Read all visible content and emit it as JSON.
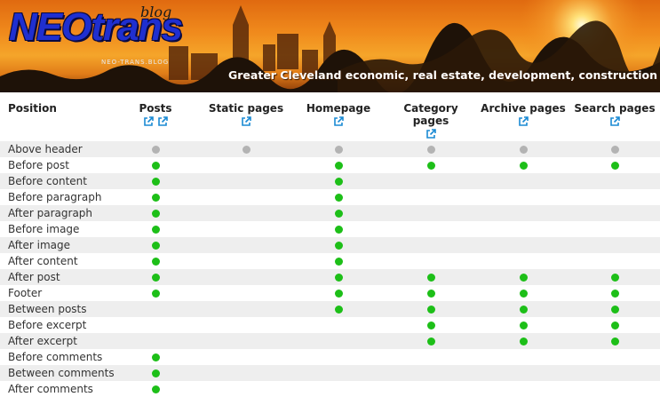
{
  "banner": {
    "logo": "NEOtrans",
    "logo_suffix": "blog",
    "site_url": "NEO-TRANS.BLOG",
    "tagline": "Greater Cleveland economic, real estate, development, construction news"
  },
  "colors": {
    "active_dot": "#1dbf18",
    "inactive_dot": "#b3b3b3",
    "link_icon": "#1a8ad4",
    "stripe": "#eeeeee"
  },
  "table": {
    "position_header": "Position",
    "columns": [
      {
        "label": "Posts",
        "link_icons": 2
      },
      {
        "label": "Static pages",
        "link_icons": 1
      },
      {
        "label": "Homepage",
        "link_icons": 1
      },
      {
        "label": "Category pages",
        "link_icons": 1
      },
      {
        "label": "Archive pages",
        "link_icons": 1
      },
      {
        "label": "Search pages",
        "link_icons": 1
      }
    ],
    "rows": [
      {
        "label": "Above header",
        "cells": [
          "na",
          "na",
          "na",
          "na",
          "na",
          "na"
        ]
      },
      {
        "label": "Before post",
        "cells": [
          "on",
          "",
          "on",
          "on",
          "on",
          "on"
        ]
      },
      {
        "label": "Before content",
        "cells": [
          "on",
          "",
          "on",
          "",
          "",
          ""
        ]
      },
      {
        "label": "Before paragraph",
        "cells": [
          "on",
          "",
          "on",
          "",
          "",
          ""
        ]
      },
      {
        "label": "After paragraph",
        "cells": [
          "on",
          "",
          "on",
          "",
          "",
          ""
        ]
      },
      {
        "label": "Before image",
        "cells": [
          "on",
          "",
          "on",
          "",
          "",
          ""
        ]
      },
      {
        "label": "After image",
        "cells": [
          "on",
          "",
          "on",
          "",
          "",
          ""
        ]
      },
      {
        "label": "After content",
        "cells": [
          "on",
          "",
          "on",
          "",
          "",
          ""
        ]
      },
      {
        "label": "After post",
        "cells": [
          "on",
          "",
          "on",
          "on",
          "on",
          "on"
        ]
      },
      {
        "label": "Footer",
        "cells": [
          "on",
          "",
          "on",
          "on",
          "on",
          "on"
        ]
      },
      {
        "label": "Between posts",
        "cells": [
          "",
          "",
          "on",
          "on",
          "on",
          "on"
        ]
      },
      {
        "label": "Before excerpt",
        "cells": [
          "",
          "",
          "",
          "on",
          "on",
          "on"
        ]
      },
      {
        "label": "After excerpt",
        "cells": [
          "",
          "",
          "",
          "on",
          "on",
          "on"
        ]
      },
      {
        "label": "Before comments",
        "cells": [
          "on",
          "",
          "",
          "",
          "",
          ""
        ]
      },
      {
        "label": "Between comments",
        "cells": [
          "on",
          "",
          "",
          "",
          "",
          ""
        ]
      },
      {
        "label": "After comments",
        "cells": [
          "on",
          "",
          "",
          "",
          "",
          ""
        ]
      }
    ]
  }
}
